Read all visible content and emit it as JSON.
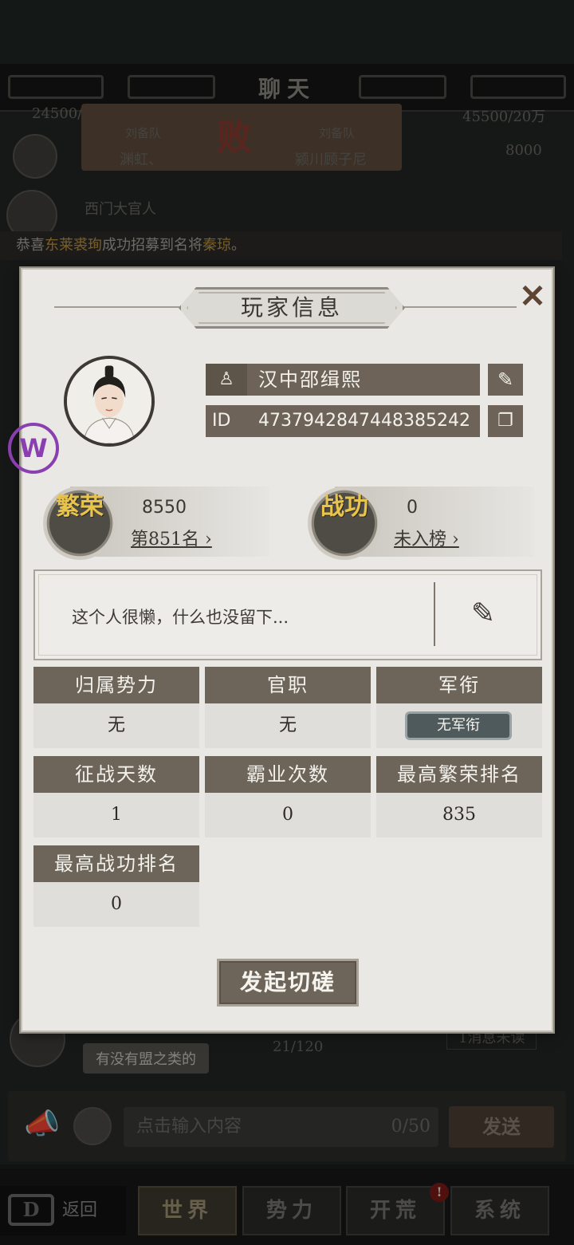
{
  "chat": {
    "title": "聊天",
    "battle_card": {
      "left_team_tag": "刘备队",
      "left_name": "渊虹、",
      "right_team_tag": "刘备队",
      "right_name": "颍川顾子尼",
      "result": "败"
    },
    "side_counts": {
      "left": "24500/",
      "right": "45500/20万",
      "right_score": "8000"
    },
    "sender_name": "西门大官人",
    "system_banner": {
      "prefix": "恭喜",
      "player": "东莱裘珣",
      "middle": "成功招募到名将",
      "general": "秦琼",
      "suffix": "。"
    },
    "last_message": "有没有盟之类的",
    "message_counter": "21/120",
    "unread_label": "1消息未读",
    "input": {
      "placeholder": "点击输入内容",
      "count": "0/50",
      "send_label": "发送"
    }
  },
  "nav": {
    "back_label": "返回",
    "back_logo": "D",
    "tabs": [
      {
        "label": "世界",
        "active": true
      },
      {
        "label": "势力",
        "active": false
      },
      {
        "label": "开荒",
        "active": false
      },
      {
        "label": "系统",
        "active": false
      }
    ],
    "badge": "!"
  },
  "side_badge": "W",
  "modal": {
    "title": "玩家信息",
    "close_icon": "✕",
    "player": {
      "name": "汉中邵缉熙",
      "id_label": "ID",
      "id_value": "4737942847448385242"
    },
    "prosperity": {
      "medal": "繁荣",
      "value": "8550",
      "rank_text": "第851名"
    },
    "merit": {
      "medal": "战功",
      "value": "0",
      "rank_text": "未入榜"
    },
    "signature": "这个人很懒，什么也没留下...",
    "info_cells": [
      {
        "label": "归属势力",
        "value": "无"
      },
      {
        "label": "官职",
        "value": "无"
      },
      {
        "label": "军衔",
        "value": "无军衔"
      },
      {
        "label": "征战天数",
        "value": "1"
      },
      {
        "label": "霸业次数",
        "value": "0"
      },
      {
        "label": "最高繁荣排名",
        "value": "835"
      },
      {
        "label": "最高战功排名",
        "value": "0"
      }
    ],
    "spar_button": "发起切磋"
  },
  "colors": {
    "panel_bg": "#e9e8e5",
    "header_cell": "#6e655a",
    "medal_gold": "#e8c44c",
    "highlight_name": "#b9923f"
  }
}
